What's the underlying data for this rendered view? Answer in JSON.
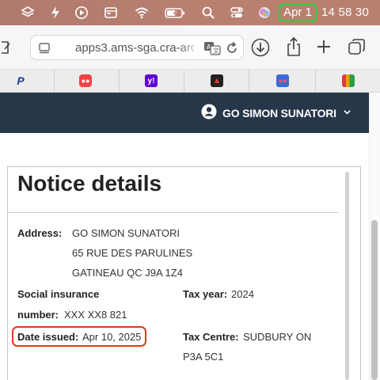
{
  "menubar": {
    "icons": [
      "layers-icon",
      "dropbox-icon",
      "script-icon",
      "media-play-icon",
      "window-icon",
      "wifi-icon",
      "battery-icon",
      "search-icon",
      "control-center-icon",
      "siri-icon"
    ],
    "date": "Apr 1",
    "time": "14 58 30",
    "highlight_color": "#27d43a"
  },
  "browser": {
    "url": "apps3.ams-sga.cra-arc",
    "buttons": [
      "sidebar-icon",
      "translate-icon",
      "reload-icon",
      "download-icon",
      "share-icon",
      "new-tab-icon",
      "tab-overview-icon"
    ]
  },
  "favorites": [
    {
      "name": "paypal",
      "color": "#1f3b8f",
      "glyph": "P"
    },
    {
      "name": "robot",
      "color": "#e44",
      "glyph": "●"
    },
    {
      "name": "yahoo",
      "color": "#6001d2",
      "glyph": "y!"
    },
    {
      "name": "arrow-app",
      "color": "#222",
      "glyph": "▲"
    },
    {
      "name": "robot-2",
      "color": "#3a6bd8",
      "glyph": "●"
    },
    {
      "name": "gift",
      "color": "#e2a400",
      "glyph": "■"
    }
  ],
  "header": {
    "user_name": "GO SIMON SUNATORI",
    "bg_color": "#26374a"
  },
  "notice": {
    "title": "Notice details",
    "address_label": "Address:",
    "address_lines": [
      "GO SIMON SUNATORI",
      "65 RUE DES PARULINES",
      "GATINEAU QC J9A 1Z4"
    ],
    "sin_label_1": "Social insurance",
    "sin_label_2": "number:",
    "sin_value": "XXX XX8 821",
    "tax_year_label": "Tax year:",
    "tax_year_value": "2024",
    "date_issued_label": "Date issued:",
    "date_issued_value": "Apr 10, 2025",
    "tax_centre_label": "Tax Centre:",
    "tax_centre_line1": "SUDBURY ON",
    "tax_centre_line2": "P3A 5C1",
    "highlight_color": "#e0371d"
  }
}
